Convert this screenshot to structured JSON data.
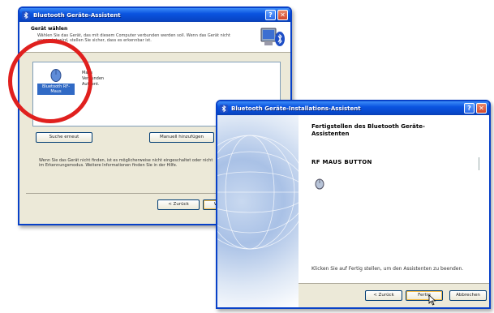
{
  "window1": {
    "title": "Bluetooth Geräte-Assistent",
    "header_title": "Gerät wählen",
    "header_desc": "Wählen Sie das Gerät, das mit diesem Computer verbunden werden soll. Wenn das Gerät nicht angezeigt wird, stellen Sie sicher, dass es erkennbar ist.",
    "device": {
      "label": "Bluetooth RF-Maus",
      "details": [
        "Maus",
        "Verbunden",
        "Authent."
      ]
    },
    "buttons": {
      "search": "Suche erneut",
      "add_manual": "Manuell hinzufügen",
      "back": "< Zurück",
      "next": "Weiter >"
    },
    "info_text": "Wenn Sie das Gerät nicht finden, ist es möglicherweise nicht eingeschaltet oder nicht im Erkennungsmodus. Weitere Informationen finden Sie in der Hilfe."
  },
  "window2": {
    "title": "Bluetooth Geräte-Installations-Assistent",
    "heading": "Fertigstellen des Bluetooth Geräte-Assistenten",
    "device_name": "RF MAUS BUTTON",
    "finish_text": "Klicken Sie auf Fertig stellen, um den Assistenten zu beenden.",
    "buttons": {
      "back": "< Zurück",
      "finish": "Fertig",
      "cancel": "Abbrechen"
    }
  },
  "colors": {
    "title_blue": "#0a54e0",
    "highlight": "#e0201e",
    "selection": "#316ac5"
  }
}
